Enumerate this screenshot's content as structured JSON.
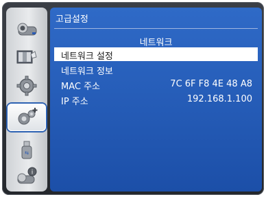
{
  "menu": {
    "title": "고급설정",
    "subtitle": "네트워크",
    "items": [
      {
        "label": "네트워크 설정",
        "value": ""
      },
      {
        "label": "네트워크 정보",
        "value": ""
      },
      {
        "label": "MAC 주소",
        "value": "7C 6F F8 4E 48 A8"
      },
      {
        "label": "IP 주소",
        "value": "192.168.1.100"
      }
    ]
  },
  "sidebar": {
    "items": [
      {
        "icon": "picture-adjust-icon"
      },
      {
        "icon": "display-setting-icon"
      },
      {
        "icon": "settings-gear-icon"
      },
      {
        "icon": "advanced-settings-icon",
        "selected": true
      },
      {
        "icon": "usb-icon"
      },
      {
        "icon": "information-icon"
      }
    ]
  },
  "colors": {
    "panel": "#1c4fa8",
    "selection": "#ffffff"
  }
}
